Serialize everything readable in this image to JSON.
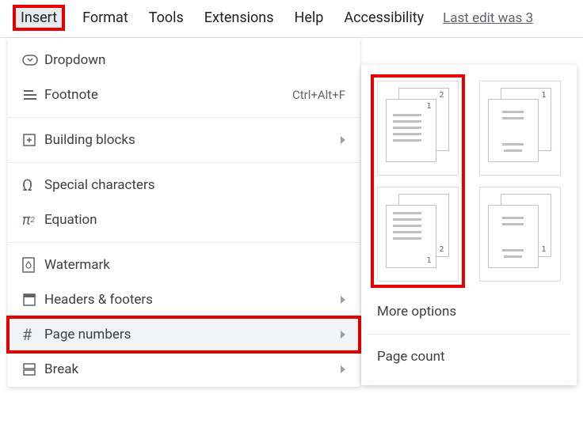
{
  "menubar": {
    "items": [
      {
        "label": "Insert",
        "active": true
      },
      {
        "label": "Format"
      },
      {
        "label": "Tools"
      },
      {
        "label": "Extensions"
      },
      {
        "label": "Help"
      },
      {
        "label": "Accessibility"
      }
    ],
    "last_edit": "Last edit was 3"
  },
  "insert_menu": {
    "dropdown": "Dropdown",
    "footnote": "Footnote",
    "footnote_shortcut": "Ctrl+Alt+F",
    "building_blocks": "Building blocks",
    "special_chars": "Special characters",
    "equation": "Equation",
    "watermark": "Watermark",
    "headers_footers": "Headers & footers",
    "page_numbers": "Page numbers",
    "break": "Break"
  },
  "page_numbers_submenu": {
    "styles": [
      {
        "id": "header-right-first",
        "desc": "Number in header, top-right, start page 1"
      },
      {
        "id": "header-right-skip",
        "desc": "Number in header, top-right, skip first"
      },
      {
        "id": "footer-right-first",
        "desc": "Number in footer, bottom-right, start page 1"
      },
      {
        "id": "footer-right-skip",
        "desc": "Number in footer, bottom-right, skip first"
      }
    ],
    "more_options": "More options",
    "page_count": "Page count"
  },
  "annotations": {
    "highlighted": [
      "menubar-insert",
      "menu-page-numbers",
      "submenu-left-column"
    ]
  }
}
